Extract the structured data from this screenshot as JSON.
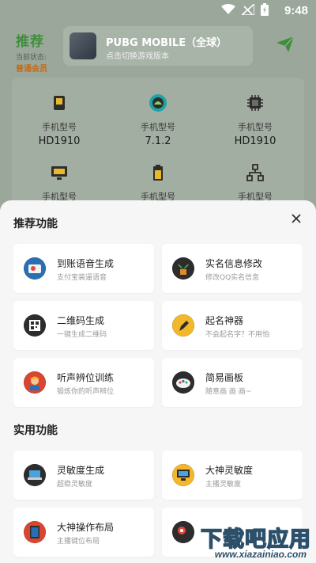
{
  "status_bar": {
    "time": "9:48",
    "wifi_icon": "wifi-icon",
    "signal_icon": "signal-icon",
    "battery_icon": "battery-charging-icon"
  },
  "header": {
    "title": "推荐",
    "state_label": "当前状态:",
    "state_value": "普通会员",
    "game": {
      "name": "PUBG MOBILE（全球）",
      "subtitle": "点击切换游戏版本"
    },
    "send_icon": "send-icon"
  },
  "devices": [
    {
      "icon": "sd-card-icon",
      "label": "手机型号",
      "value": "HD1910"
    },
    {
      "icon": "android-icon",
      "label": "手机型号",
      "value": "7.1.2"
    },
    {
      "icon": "chip-icon",
      "label": "手机型号",
      "value": "HD1910"
    },
    {
      "icon": "monitor-icon",
      "label": "手机型号",
      "value": ""
    },
    {
      "icon": "battery-icon",
      "label": "手机型号",
      "value": ""
    },
    {
      "icon": "network-icon",
      "label": "手机型号",
      "value": ""
    }
  ],
  "sheet": {
    "close_icon": "close-icon",
    "sections": [
      {
        "title": "推荐功能",
        "items": [
          {
            "title": "到账语音生成",
            "subtitle": "支付宝装逼语音",
            "icon": "payment-voice-icon"
          },
          {
            "title": "实名信息修改",
            "subtitle": "修改QQ实名信息",
            "icon": "plant-icon"
          },
          {
            "title": "二维码生成",
            "subtitle": "一键生成二维码",
            "icon": "qrcode-icon"
          },
          {
            "title": "起名神器",
            "subtitle": "不会起名字？不用怕",
            "icon": "pen-icon"
          },
          {
            "title": "听声辨位训练",
            "subtitle": "锻炼你的听声辨位",
            "icon": "soldier-icon"
          },
          {
            "title": "简易画板",
            "subtitle": "随意画 画 画~",
            "icon": "palette-icon"
          }
        ]
      },
      {
        "title": "实用功能",
        "items": [
          {
            "title": "灵敏度生成",
            "subtitle": "超稳灵敏度",
            "icon": "laptop-icon"
          },
          {
            "title": "大神灵敏度",
            "subtitle": "主播灵敏度",
            "icon": "desktop-icon"
          },
          {
            "title": "大神操作布局",
            "subtitle": "主播键位布局",
            "icon": "tablet-icon"
          },
          {
            "title": "",
            "subtitle": "",
            "icon": "map-icon"
          }
        ]
      }
    ]
  },
  "watermark": {
    "main": "下载吧应用",
    "url": "www.xiazainiao.com"
  },
  "colors": {
    "brand_green": "#3f8f3a",
    "member_orange": "#c76a12",
    "sheet_bg": "#f6f6f6",
    "card_bg": "#ffffff"
  }
}
